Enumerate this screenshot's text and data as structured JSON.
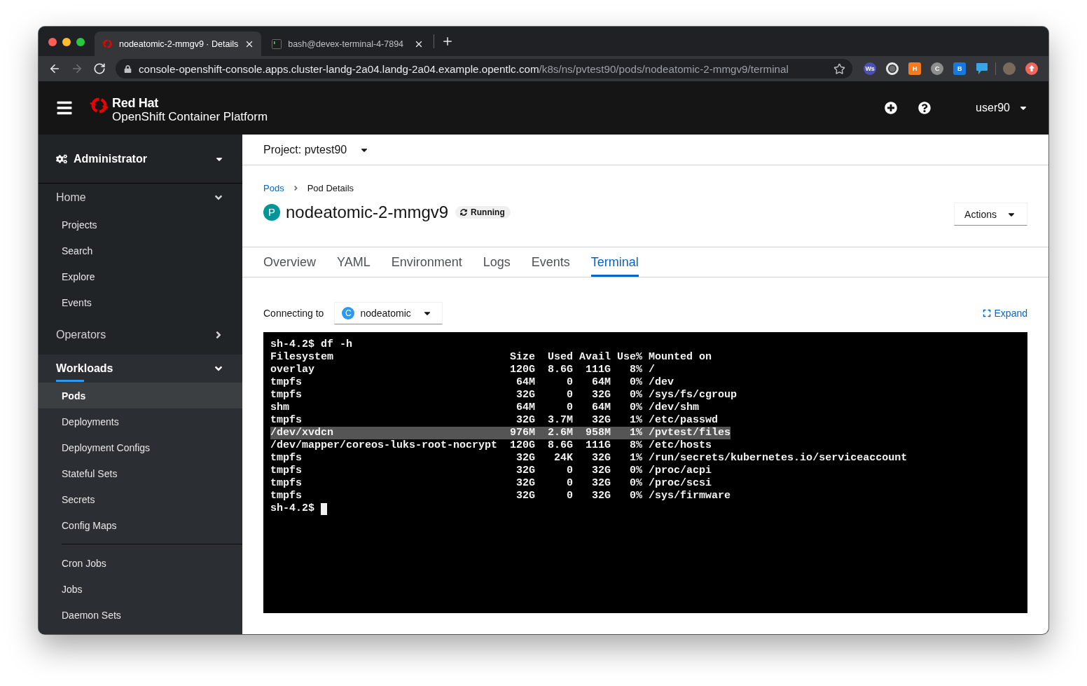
{
  "browser": {
    "tabs": [
      {
        "kind": "openshift",
        "title": "nodeatomic-2-mmgv9 · Details",
        "selected": true
      },
      {
        "kind": "terminal",
        "title": "bash@devex-terminal-4-7894",
        "selected": false
      }
    ],
    "nav_buttons": [
      {
        "kind": "back",
        "disabled": false
      },
      {
        "kind": "forward",
        "disabled": true
      },
      {
        "kind": "reload",
        "disabled": false
      }
    ],
    "address": {
      "host": "console-openshift-console.apps.cluster-landg-2a04.landg-2a04.example.opentlc.com",
      "path": "/k8s/ns/pvtest90/pods/nodeatomic-2-mmgv9/terminal"
    },
    "extensions": [
      {
        "kind": "disc",
        "label": "Ws",
        "color": "#4b4fb8"
      },
      {
        "kind": "ring",
        "color": "#e6e6e6"
      },
      {
        "kind": "tile",
        "label": "H",
        "color": "#f47b20"
      },
      {
        "kind": "disc",
        "label": "C",
        "color": "#8e8e8e"
      },
      {
        "kind": "tile",
        "label": "B",
        "color": "#1778e0"
      },
      {
        "kind": "bubble",
        "color": "#3ea3e3"
      }
    ]
  },
  "masthead": {
    "brand": "Red Hat",
    "product": "OpenShift Container Platform",
    "user": "user90"
  },
  "sidebar": {
    "perspective": "Administrator",
    "sections": [
      {
        "label": "Home",
        "expanded": true,
        "selected": false,
        "groups": [
          {
            "items": [
              {
                "label": "Projects",
                "selected": false
              },
              {
                "label": "Search",
                "selected": false
              },
              {
                "label": "Explore",
                "selected": false
              },
              {
                "label": "Events",
                "selected": false
              }
            ]
          }
        ]
      },
      {
        "label": "Operators",
        "expanded": false,
        "selected": false
      },
      {
        "label": "Workloads",
        "expanded": true,
        "selected": true,
        "groups": [
          {
            "items": [
              {
                "label": "Pods",
                "selected": true
              },
              {
                "label": "Deployments",
                "selected": false
              },
              {
                "label": "Deployment Configs",
                "selected": false
              },
              {
                "label": "Stateful Sets",
                "selected": false
              },
              {
                "label": "Secrets",
                "selected": false
              },
              {
                "label": "Config Maps",
                "selected": false
              }
            ]
          },
          {
            "items": [
              {
                "label": "Cron Jobs",
                "selected": false
              },
              {
                "label": "Jobs",
                "selected": false
              },
              {
                "label": "Daemon Sets",
                "selected": false
              }
            ]
          }
        ]
      }
    ]
  },
  "project_bar": {
    "label": "Project: pvtest90"
  },
  "breadcrumb": [
    {
      "label": "Pods",
      "link": true
    },
    {
      "label": "Pod Details",
      "link": false
    }
  ],
  "header": {
    "kind_badge": "P",
    "title": "nodeatomic-2-mmgv9",
    "status": "Running",
    "actions": "Actions"
  },
  "tabs": [
    {
      "label": "Overview",
      "selected": false
    },
    {
      "label": "YAML",
      "selected": false
    },
    {
      "label": "Environment",
      "selected": false
    },
    {
      "label": "Logs",
      "selected": false
    },
    {
      "label": "Events",
      "selected": false
    },
    {
      "label": "Terminal",
      "selected": true
    }
  ],
  "terminal": {
    "connecting_label": "Connecting to",
    "container_badge": "C",
    "container": "nodeatomic",
    "expand": "Expand",
    "lines": [
      {
        "kind": "text",
        "text": "sh-4.2$ df -h",
        "selected": false
      },
      {
        "kind": "text",
        "text": "Filesystem                            Size  Used Avail Use% Mounted on",
        "selected": false
      },
      {
        "kind": "text",
        "text": "overlay                               120G  8.6G  111G   8% /",
        "selected": false
      },
      {
        "kind": "text",
        "text": "tmpfs                                  64M     0   64M   0% /dev",
        "selected": false
      },
      {
        "kind": "text",
        "text": "tmpfs                                  32G     0   32G   0% /sys/fs/cgroup",
        "selected": false
      },
      {
        "kind": "text",
        "text": "shm                                    64M     0   64M   0% /dev/shm",
        "selected": false
      },
      {
        "kind": "text",
        "text": "tmpfs                                  32G  3.7M   32G   1% /etc/passwd",
        "selected": false
      },
      {
        "kind": "text",
        "text": "/dev/xvdcn                            976M  2.6M  958M   1% /pvtest/files",
        "selected": true
      },
      {
        "kind": "text",
        "text": "/dev/mapper/coreos-luks-root-nocrypt  120G  8.6G  111G   8% /etc/hosts",
        "selected": false
      },
      {
        "kind": "text",
        "text": "tmpfs                                  32G   24K   32G   1% /run/secrets/kubernetes.io/serviceaccount",
        "selected": false
      },
      {
        "kind": "text",
        "text": "tmpfs                                  32G     0   32G   0% /proc/acpi",
        "selected": false
      },
      {
        "kind": "text",
        "text": "tmpfs                                  32G     0   32G   0% /proc/scsi",
        "selected": false
      },
      {
        "kind": "text",
        "text": "tmpfs                                  32G     0   32G   0% /sys/firmware",
        "selected": false
      },
      {
        "kind": "prompt",
        "text": "sh-4.2$",
        "selected": false
      }
    ]
  }
}
